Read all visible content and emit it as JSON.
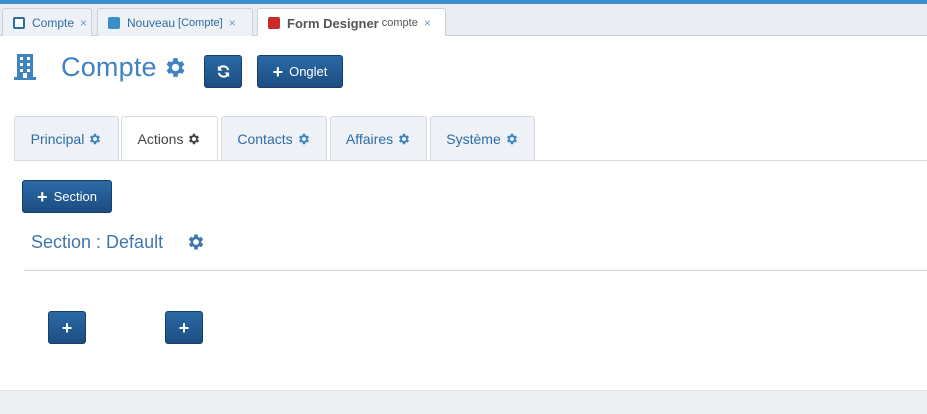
{
  "doc_tabs": [
    {
      "label": "Compte",
      "sub": "",
      "icon": "outline-square-icon",
      "close": "×"
    },
    {
      "label": "Nouveau",
      "sub": "[Compte]",
      "icon": "blue-square-icon",
      "close": "×"
    },
    {
      "label": "Form Designer",
      "sub": "compte",
      "icon": "red-square-icon",
      "close": "×",
      "active": true
    }
  ],
  "header": {
    "title": "Compte",
    "entity_icon": "building-icon",
    "settings_icon": "gear-icon",
    "refresh_icon": "refresh-icon",
    "add_tab_label": "Onglet"
  },
  "form_tabs": [
    {
      "label": "Principal",
      "active": false
    },
    {
      "label": "Actions",
      "active": true
    },
    {
      "label": "Contacts",
      "active": false
    },
    {
      "label": "Affaires",
      "active": false
    },
    {
      "label": "Système",
      "active": false
    }
  ],
  "section": {
    "add_label": "Section",
    "title": "Section : Default"
  },
  "colors": {
    "accent": "#3a8fcb",
    "button": "#1f5890",
    "link": "#2e6da4",
    "close_tab_red": "#cc2b2b"
  }
}
